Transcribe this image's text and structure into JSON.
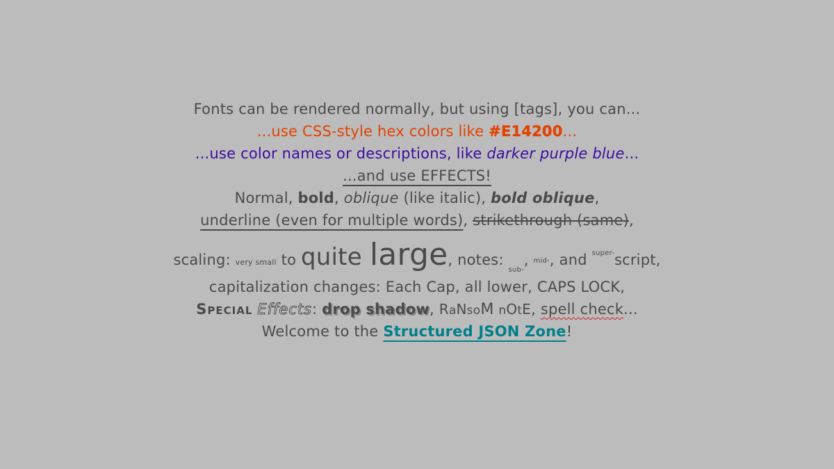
{
  "colors": {
    "background": "#bcbcbc",
    "text": "#4a4a4a",
    "orange": "#e14200",
    "purple": "#3a0da0",
    "teal": "#00808a"
  },
  "line1": "Fonts can be rendered normally, but using [tags], you can...",
  "line2": {
    "pre": "...use CSS-style hex colors like ",
    "hex": "#E14200",
    "post": "..."
  },
  "line3": {
    "pre": "...use color names or descriptions, like ",
    "example": "darker purple blue",
    "post": "..."
  },
  "line4": "...and use EFFECTS!",
  "line5": {
    "normal": "Normal, ",
    "bold": "bold",
    "sep1": ", ",
    "oblique": "oblique",
    "like_italic": " (like italic), ",
    "bold_oblique": "bold oblique",
    "end": ","
  },
  "line6": {
    "underline": "underline (even for multiple words)",
    "sep": ", ",
    "strike": "strikethrough (same)",
    "end": ","
  },
  "line7": {
    "scaling": "scaling: ",
    "very_small": "very small",
    "to": " to ",
    "quite": "quite ",
    "large": "large",
    "notes": ", notes: ",
    "sub": "sub-",
    "comma1": ", ",
    "mid": "mid-",
    "and": ", and ",
    "super": "super-",
    "script": "script,"
  },
  "line8": "capitalization changes: Each Cap, all lower, CAPS LOCK,",
  "line9": {
    "special": "Special",
    "effects": "Effects",
    "colon": ": ",
    "drop_shadow": "drop shadow",
    "sep1": ", ",
    "ransom": [
      "R",
      "a",
      "N",
      "s",
      "o",
      "M",
      " ",
      "n",
      "O",
      "t",
      "E"
    ],
    "sep2": ", ",
    "spell_check": "spell check",
    "end": "..."
  },
  "line10": {
    "pre": "Welcome to the ",
    "link": "Structured JSON Zone",
    "post": "!"
  }
}
